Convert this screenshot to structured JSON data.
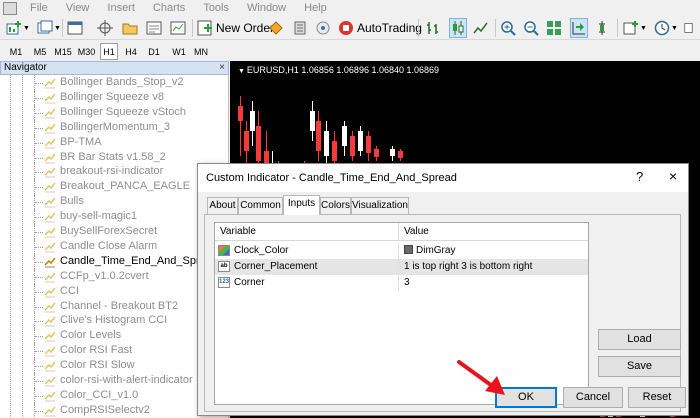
{
  "menu": [
    "File",
    "View",
    "Insert",
    "Charts",
    "Tools",
    "Window",
    "Help"
  ],
  "toolbar": {
    "new_order": "New Order",
    "autotrading": "AutoTrading"
  },
  "timeframes": [
    "M1",
    "M5",
    "M15",
    "M30",
    "H1",
    "H4",
    "D1",
    "W1",
    "MN"
  ],
  "timeframe_active": "H1",
  "navigator": {
    "title": "Navigator",
    "close": "×",
    "items": [
      "Bollinger Bands_Stop_v2",
      "Bollinger Squeeze v8",
      "Bollinger Squeeze vStoch",
      "BollingerMomentum_3",
      "BP-TMA",
      "BR Bar Stats v1.58_2",
      "breakout-rsi-indicator",
      "Breakout_PANCA_EAGLE",
      "Bulls",
      "buy-sell-magic1",
      "BuySellForexSecret",
      "Candle Close Alarm",
      "Candle_Time_End_And_Spread",
      "CCFp_v1.0.2cvert",
      "CCI",
      "Channel - Breakout BT2",
      "Clive's Histogram CCI",
      "Color Levels",
      "Color RSI Fast",
      "Color RSI Slow",
      "color-rsi-with-alert-indicator",
      "Color_CCI_v1.0",
      "CompRSISelectv2"
    ],
    "selected": "Candle_Time_End_And_Spread"
  },
  "chart": {
    "title": "EURUSD,H1  1.06856 1.06896 1.06840 1.06869"
  },
  "dialog": {
    "title": "Custom Indicator - Candle_Time_End_And_Spread",
    "help": "?",
    "close": "×",
    "tabs": [
      "About",
      "Common",
      "Inputs",
      "Colors",
      "Visualization"
    ],
    "active_tab": "Inputs",
    "columns": [
      "Variable",
      "Value"
    ],
    "rows": [
      {
        "type": "color",
        "name": "Clock_Color",
        "value": "DimGray",
        "swatch": "#696969"
      },
      {
        "type": "ab",
        "name": "Corner_Placement",
        "value": "1 is top right 3 is bottom right"
      },
      {
        "type": "int",
        "name": "Corner",
        "value": "3"
      }
    ],
    "buttons": {
      "load": "Load",
      "save": "Save",
      "ok": "OK",
      "cancel": "Cancel",
      "reset": "Reset"
    }
  },
  "colors": {
    "accent": "#0078d7",
    "arrow": "#e8141b",
    "bear": "#f23b3b",
    "bull": "#ffffff"
  }
}
